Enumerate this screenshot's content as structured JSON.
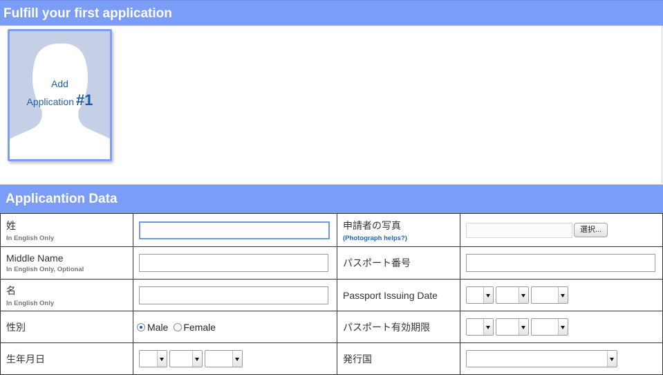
{
  "section1": {
    "title": "Fulfill your first application"
  },
  "add_card": {
    "line1": "Add",
    "line2": "Application",
    "number": "#1"
  },
  "section2": {
    "title": "Applicantion Data"
  },
  "rows": [
    {
      "left_label": "姓",
      "left_sub": "In English Only",
      "right_label": "申請者の写真",
      "right_sub": "(Photograph helps?)",
      "file_button": "選択..."
    },
    {
      "left_label": "Middle Name",
      "left_sub": "In English Only, Optional",
      "right_label": "パスポート番号"
    },
    {
      "left_label": "名",
      "left_sub": "In English Only",
      "right_label": "Passport Issuing Date"
    },
    {
      "left_label": "性別",
      "gender_male": "Male",
      "gender_female": "Female",
      "gender_selected": "Male",
      "right_label": "パスポート有効期限"
    },
    {
      "left_label": "生年月日",
      "right_label": "発行国"
    }
  ],
  "colors": {
    "header_bar": "#7b9cf7",
    "link_blue": "#2165b8",
    "card_bg": "#c5d0e6"
  },
  "icons": {
    "avatar": "person-silhouette-icon",
    "select_arrow": "chevron-down-icon"
  }
}
